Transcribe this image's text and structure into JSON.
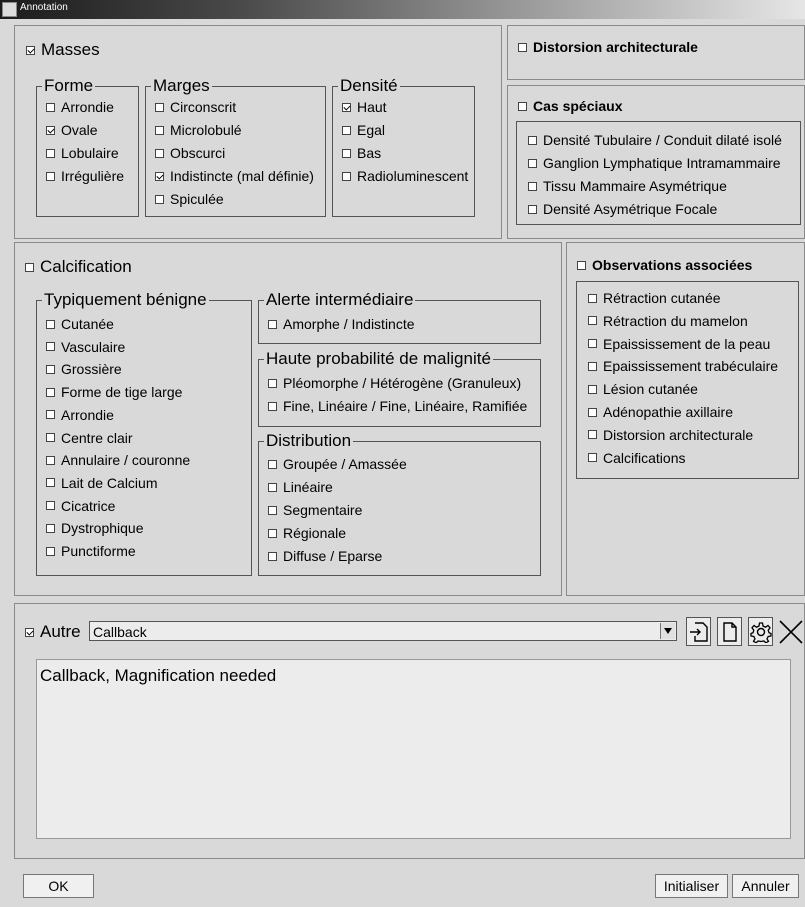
{
  "window": {
    "title": "Annotation"
  },
  "masses": {
    "label": "Masses",
    "checked": true,
    "forme": {
      "title": "Forme",
      "items": [
        {
          "label": "Arrondie",
          "checked": false
        },
        {
          "label": "Ovale",
          "checked": true
        },
        {
          "label": "Lobulaire",
          "checked": false
        },
        {
          "label": "Irrégulière",
          "checked": false
        }
      ]
    },
    "marges": {
      "title": "Marges",
      "items": [
        {
          "label": "Circonscrit",
          "checked": false
        },
        {
          "label": "Microlobulé",
          "checked": false
        },
        {
          "label": "Obscurci",
          "checked": false
        },
        {
          "label": "Indistincte (mal définie)",
          "checked": true
        },
        {
          "label": "Spiculée",
          "checked": false
        }
      ]
    },
    "densite": {
      "title": "Densité",
      "items": [
        {
          "label": "Haut",
          "checked": true
        },
        {
          "label": "Egal",
          "checked": false
        },
        {
          "label": "Bas",
          "checked": false
        },
        {
          "label": "Radioluminescent",
          "checked": false
        }
      ]
    }
  },
  "distorsion": {
    "label": "Distorsion architecturale",
    "checked": false
  },
  "cas_speciaux": {
    "label": "Cas spéciaux",
    "checked": false,
    "items": [
      {
        "label": "Densité Tubulaire / Conduit dilaté isolé",
        "checked": false
      },
      {
        "label": "Ganglion Lymphatique Intramammaire",
        "checked": false
      },
      {
        "label": "Tissu Mammaire Asymétrique",
        "checked": false
      },
      {
        "label": "Densité Asymétrique Focale",
        "checked": false
      }
    ]
  },
  "calcification": {
    "label": "Calcification",
    "checked": false,
    "benigne": {
      "title": "Typiquement bénigne",
      "items": [
        {
          "label": "Cutanée",
          "checked": false
        },
        {
          "label": "Vasculaire",
          "checked": false
        },
        {
          "label": "Grossière",
          "checked": false
        },
        {
          "label": "Forme de tige large",
          "checked": false
        },
        {
          "label": "Arrondie",
          "checked": false
        },
        {
          "label": "Centre clair",
          "checked": false
        },
        {
          "label": "Annulaire / couronne",
          "checked": false
        },
        {
          "label": "Lait de Calcium",
          "checked": false
        },
        {
          "label": "Cicatrice",
          "checked": false
        },
        {
          "label": "Dystrophique",
          "checked": false
        },
        {
          "label": "Punctiforme",
          "checked": false
        }
      ]
    },
    "intermediaire": {
      "title": "Alerte intermédiaire",
      "items": [
        {
          "label": "Amorphe / Indistincte",
          "checked": false
        }
      ]
    },
    "haute": {
      "title": "Haute probabilité de malignité",
      "items": [
        {
          "label": "Pléomorphe / Hétérogène (Granuleux)",
          "checked": false
        },
        {
          "label": "Fine, Linéaire / Fine, Linéaire, Ramifiée",
          "checked": false
        }
      ]
    },
    "distribution": {
      "title": "Distribution",
      "items": [
        {
          "label": "Groupée / Amassée",
          "checked": false
        },
        {
          "label": "Linéaire",
          "checked": false
        },
        {
          "label": "Segmentaire",
          "checked": false
        },
        {
          "label": "Régionale",
          "checked": false
        },
        {
          "label": "Diffuse / Eparse",
          "checked": false
        }
      ]
    }
  },
  "observations": {
    "label": "Observations associées",
    "checked": false,
    "items": [
      {
        "label": "Rétraction cutanée",
        "checked": false
      },
      {
        "label": "Rétraction du mamelon",
        "checked": false
      },
      {
        "label": "Epaississement de la peau",
        "checked": false
      },
      {
        "label": "Epaississement trabéculaire",
        "checked": false
      },
      {
        "label": "Lésion cutanée",
        "checked": false
      },
      {
        "label": "Adénopathie axillaire",
        "checked": false
      },
      {
        "label": "Distorsion architecturale",
        "checked": false
      },
      {
        "label": "Calcifications",
        "checked": false
      }
    ]
  },
  "autre": {
    "label": "Autre",
    "checked": true,
    "select_value": "Callback",
    "text": "Callback, Magnification needed",
    "icons": [
      "import-icon",
      "new-document-icon",
      "settings-icon",
      "close-icon"
    ]
  },
  "footer": {
    "ok": "OK",
    "initialiser": "Initialiser",
    "annuler": "Annuler"
  }
}
